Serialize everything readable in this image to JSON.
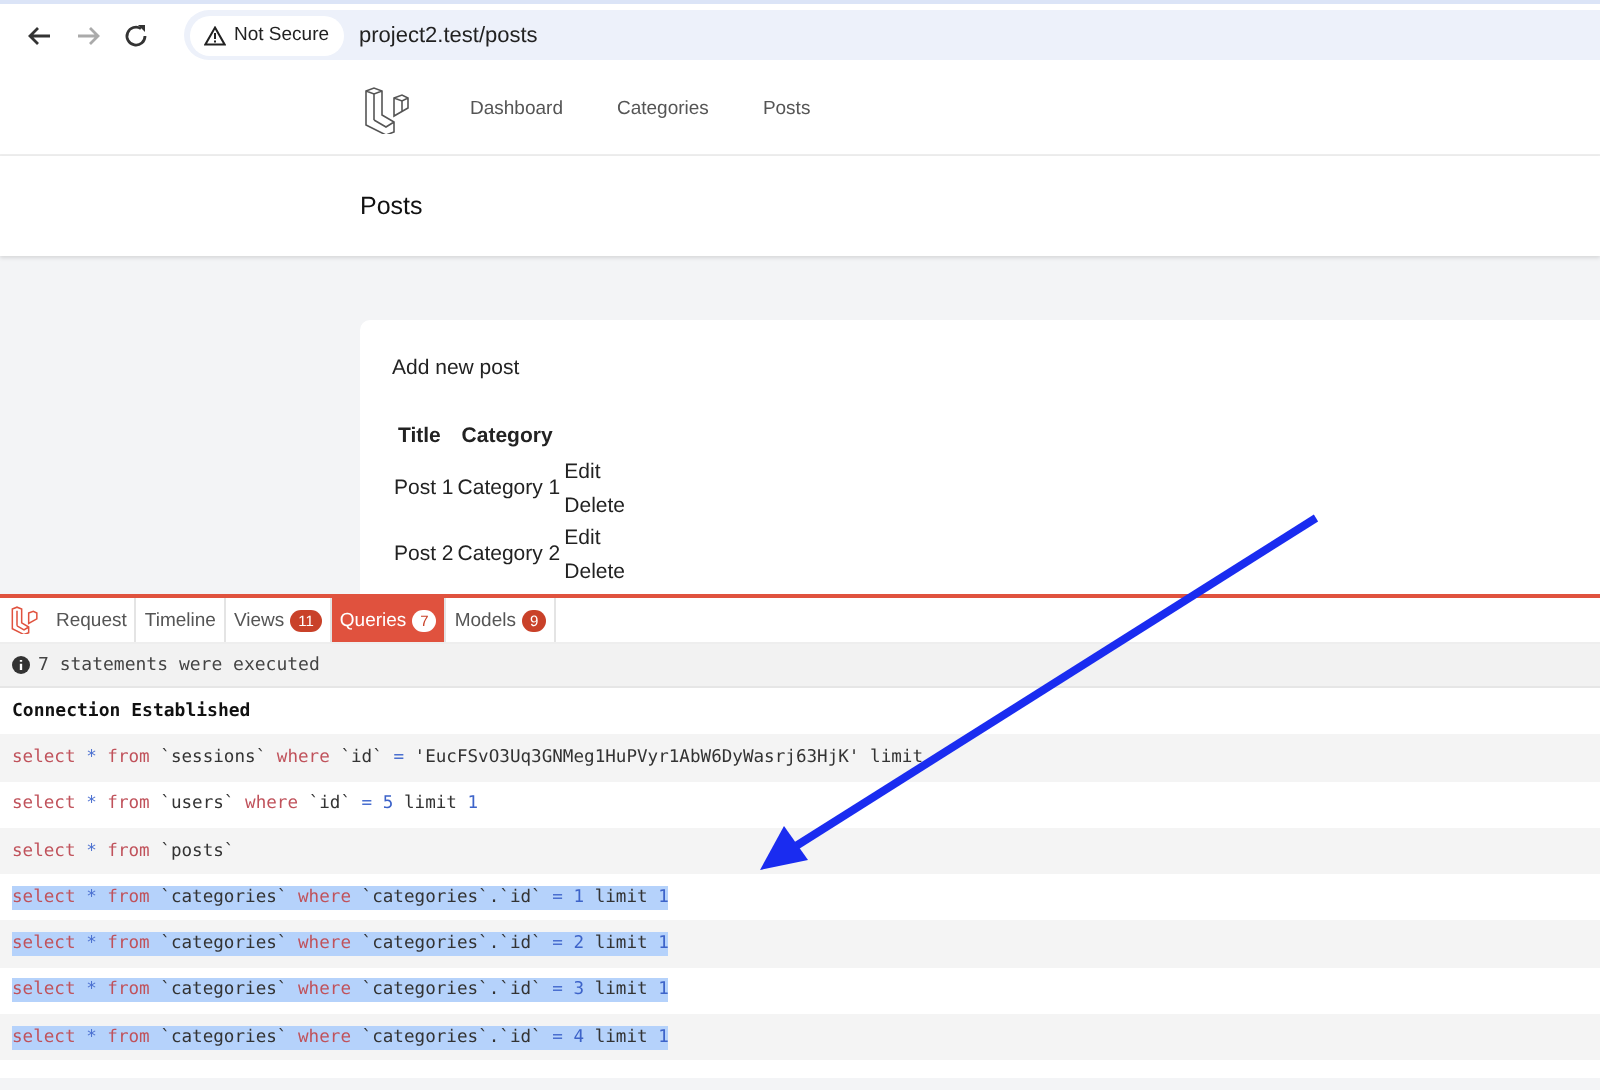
{
  "browser": {
    "security": "Not Secure",
    "url": "project2.test/posts"
  },
  "nav": {
    "links": [
      {
        "label": "Dashboard",
        "selected": false
      },
      {
        "label": "Categories",
        "selected": false
      },
      {
        "label": "Posts",
        "selected": false
      }
    ]
  },
  "header": {
    "title": "Posts"
  },
  "card": {
    "add_link": "Add new post",
    "table": {
      "columns": [
        "Title",
        "Category"
      ],
      "rows": [
        {
          "title": "Post 1",
          "category": "Category 1",
          "actions": [
            "Edit",
            "Delete"
          ]
        },
        {
          "title": "Post 2",
          "category": "Category 2",
          "actions": [
            "Edit",
            "Delete"
          ]
        }
      ]
    }
  },
  "debugbar": {
    "tabs": [
      {
        "label": "Request",
        "selected": false
      },
      {
        "label": "Timeline",
        "selected": false
      },
      {
        "label": "Views",
        "badge": "11",
        "selected": false
      },
      {
        "label": "Queries",
        "badge": "7",
        "selected": true
      },
      {
        "label": "Models",
        "badge": "9",
        "selected": false
      }
    ],
    "summary": "7 statements were executed",
    "connection": "Connection Established",
    "queries": [
      {
        "selected": false,
        "tokens": [
          {
            "kind": "keyword",
            "text": "select"
          },
          {
            "kind": "op",
            "text": "*"
          },
          {
            "kind": "keyword",
            "text": "from"
          },
          {
            "kind": "ident",
            "text": "`sessions`"
          },
          {
            "kind": "keyword",
            "text": "where"
          },
          {
            "kind": "ident",
            "text": "`id`"
          },
          {
            "kind": "op",
            "text": "="
          },
          {
            "kind": "ident",
            "text": "'EucFSvO3Uq3GNMeg1HuPVyr1AbW6DyWasrj63HjK'"
          },
          {
            "kind": "ident",
            "text": "limit"
          }
        ]
      },
      {
        "selected": false,
        "tokens": [
          {
            "kind": "keyword",
            "text": "select"
          },
          {
            "kind": "op",
            "text": "*"
          },
          {
            "kind": "keyword",
            "text": "from"
          },
          {
            "kind": "ident",
            "text": "`users`"
          },
          {
            "kind": "keyword",
            "text": "where"
          },
          {
            "kind": "ident",
            "text": "`id`"
          },
          {
            "kind": "op",
            "text": "="
          },
          {
            "kind": "number",
            "text": "5"
          },
          {
            "kind": "ident",
            "text": "limit"
          },
          {
            "kind": "number",
            "text": "1"
          }
        ]
      },
      {
        "selected": false,
        "tokens": [
          {
            "kind": "keyword",
            "text": "select"
          },
          {
            "kind": "op",
            "text": "*"
          },
          {
            "kind": "keyword",
            "text": "from"
          },
          {
            "kind": "ident",
            "text": "`posts`"
          }
        ]
      },
      {
        "selected": true,
        "tokens": [
          {
            "kind": "keyword",
            "text": "select"
          },
          {
            "kind": "op",
            "text": "*"
          },
          {
            "kind": "keyword",
            "text": "from"
          },
          {
            "kind": "ident",
            "text": "`categories`"
          },
          {
            "kind": "keyword",
            "text": "where"
          },
          {
            "kind": "ident",
            "text": "`categories`.`id`"
          },
          {
            "kind": "op",
            "text": "="
          },
          {
            "kind": "number",
            "text": "1"
          },
          {
            "kind": "ident",
            "text": "limit"
          },
          {
            "kind": "number",
            "text": "1"
          }
        ]
      },
      {
        "selected": true,
        "tokens": [
          {
            "kind": "keyword",
            "text": "select"
          },
          {
            "kind": "op",
            "text": "*"
          },
          {
            "kind": "keyword",
            "text": "from"
          },
          {
            "kind": "ident",
            "text": "`categories`"
          },
          {
            "kind": "keyword",
            "text": "where"
          },
          {
            "kind": "ident",
            "text": "`categories`.`id`"
          },
          {
            "kind": "op",
            "text": "="
          },
          {
            "kind": "number",
            "text": "2"
          },
          {
            "kind": "ident",
            "text": "limit"
          },
          {
            "kind": "number",
            "text": "1"
          }
        ]
      },
      {
        "selected": true,
        "tokens": [
          {
            "kind": "keyword",
            "text": "select"
          },
          {
            "kind": "op",
            "text": "*"
          },
          {
            "kind": "keyword",
            "text": "from"
          },
          {
            "kind": "ident",
            "text": "`categories`"
          },
          {
            "kind": "keyword",
            "text": "where"
          },
          {
            "kind": "ident",
            "text": "`categories`.`id`"
          },
          {
            "kind": "op",
            "text": "="
          },
          {
            "kind": "number",
            "text": "3"
          },
          {
            "kind": "ident",
            "text": "limit"
          },
          {
            "kind": "number",
            "text": "1"
          }
        ]
      },
      {
        "selected": true,
        "tokens": [
          {
            "kind": "keyword",
            "text": "select"
          },
          {
            "kind": "op",
            "text": "*"
          },
          {
            "kind": "keyword",
            "text": "from"
          },
          {
            "kind": "ident",
            "text": "`categories`"
          },
          {
            "kind": "keyword",
            "text": "where"
          },
          {
            "kind": "ident",
            "text": "`categories`.`id`"
          },
          {
            "kind": "op",
            "text": "="
          },
          {
            "kind": "number",
            "text": "4"
          },
          {
            "kind": "ident",
            "text": "limit"
          },
          {
            "kind": "number",
            "text": "1"
          }
        ]
      }
    ]
  }
}
